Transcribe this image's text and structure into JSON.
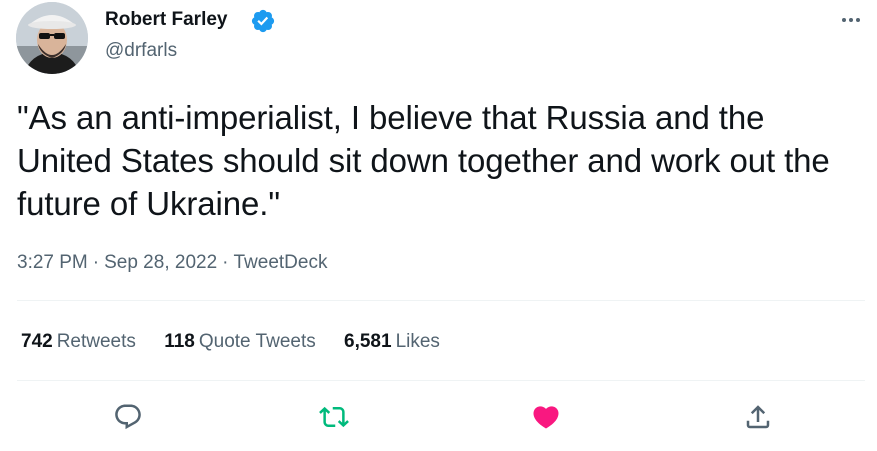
{
  "author": {
    "display_name": "Robert Farley",
    "handle": "@drfarls",
    "verified": true
  },
  "tweet": {
    "text": "\"As an anti-imperialist, I believe that Russia and the United States should sit down together and work out the future of Ukraine.\"",
    "time": "3:27 PM",
    "separator": "·",
    "date": "Sep 28, 2022",
    "source": "TweetDeck"
  },
  "stats": {
    "retweets": {
      "count": "742",
      "label": "Retweets"
    },
    "quote_tweets": {
      "count": "118",
      "label": "Quote Tweets"
    },
    "likes": {
      "count": "6,581",
      "label": "Likes"
    }
  },
  "actions": [
    {
      "icon": "reply-icon",
      "color": "#536471"
    },
    {
      "icon": "retweet-icon",
      "color": "#00ba7c",
      "active": true
    },
    {
      "icon": "like-icon",
      "color": "#f91880",
      "active": true
    },
    {
      "icon": "share-icon",
      "color": "#536471"
    }
  ],
  "colors": {
    "verified_badge": "#1d9bf0",
    "secondary_text": "#536471",
    "primary_text": "#0f1419",
    "divider": "#eff3f4"
  }
}
